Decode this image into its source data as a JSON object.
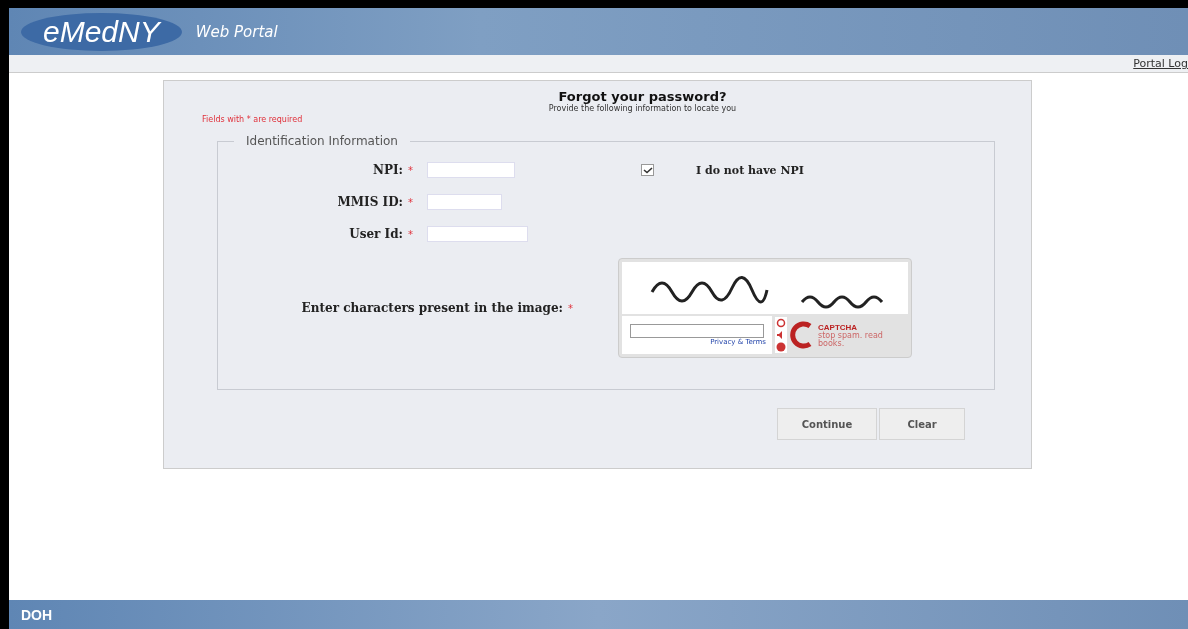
{
  "header": {
    "logo": "eMedNY",
    "subtitle": "Web Portal"
  },
  "nav": {
    "link": "Portal Log"
  },
  "form": {
    "title": "Forgot your password?",
    "subtitle": "Provide the following information to locate you",
    "required_note": "Fields with * are required",
    "section": "Identification Information",
    "fields": [
      {
        "label": "NPI:",
        "required": "*"
      },
      {
        "label": "MMIS ID:",
        "required": "*"
      },
      {
        "label": "User Id:",
        "required": "*"
      }
    ],
    "no_npi": {
      "label": "I do not have NPI",
      "checked": true
    },
    "captcha": {
      "label": "Enter characters present in the image:",
      "required": "*",
      "link": "Privacy & Terms",
      "logo": "CAPTCHA",
      "tagline": "stop spam. read books."
    },
    "buttons": [
      "Continue",
      "Clear"
    ]
  },
  "footer": {
    "logo": "DOH"
  }
}
